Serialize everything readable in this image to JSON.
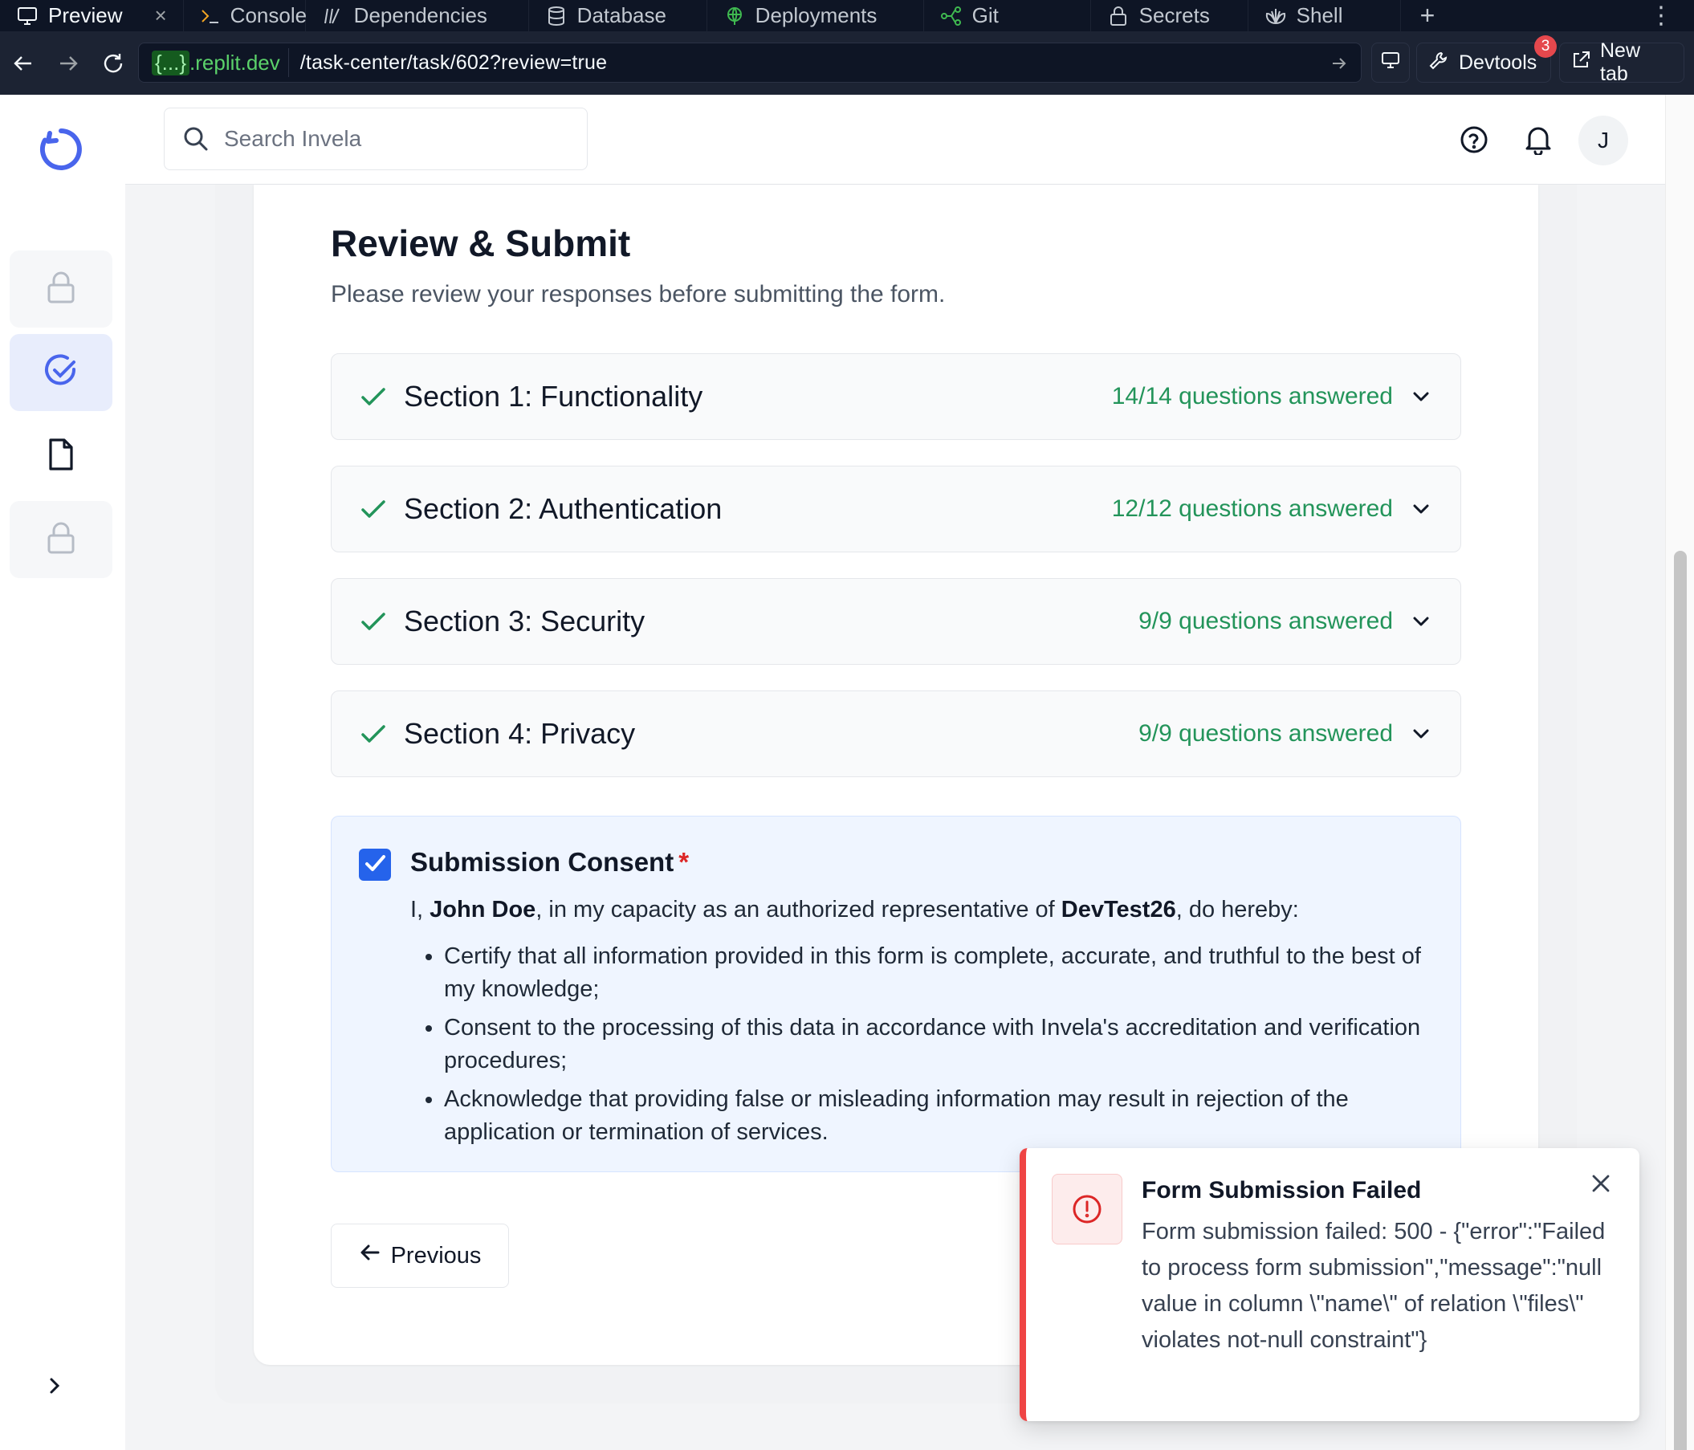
{
  "browser": {
    "tabs": [
      {
        "label": "Preview",
        "icon": "monitor-icon"
      },
      {
        "label": "Console",
        "icon": "terminal-icon"
      },
      {
        "label": "Dependencies",
        "icon": "package-icon"
      },
      {
        "label": "Database",
        "icon": "database-icon"
      },
      {
        "label": "Deployments",
        "icon": "globe-icon"
      },
      {
        "label": "Git",
        "icon": "git-icon"
      },
      {
        "label": "Secrets",
        "icon": "lock-icon"
      },
      {
        "label": "Shell",
        "icon": "shell-icon"
      }
    ],
    "tab_close_glyph": "×",
    "new_tab_glyph": "+",
    "more_glyph": "⋮",
    "url": {
      "domain_brace": "{...}",
      "domain_suffix": ".replit.dev",
      "path": "/task-center/task/602?review=true"
    },
    "devtools_label": "Devtools",
    "devtools_badge": "3",
    "new_tab_label": "New tab"
  },
  "header": {
    "search_placeholder": "Search Invela",
    "avatar_initial": "J"
  },
  "page": {
    "title": "Review & Submit",
    "subtitle": "Please review your responses before submitting the form.",
    "sections": [
      {
        "title": "Section 1: Functionality",
        "count": "14/14 questions answered"
      },
      {
        "title": "Section 2: Authentication",
        "count": "12/12 questions answered"
      },
      {
        "title": "Section 3: Security",
        "count": "9/9 questions answered"
      },
      {
        "title": "Section 4: Privacy",
        "count": "9/9 questions answered"
      }
    ],
    "consent": {
      "title": "Submission Consent",
      "required_mark": "*",
      "checked": true,
      "intro_prefix": "I, ",
      "name": "John Doe",
      "intro_middle": ", in my capacity as an authorized representative of ",
      "company": "DevTest26",
      "intro_suffix": ", do hereby:",
      "items": [
        "Certify that all information provided in this form is complete, accurate, and truthful to the best of my knowledge;",
        "Consent to the processing of this data in accordance with Invela's accreditation and verification procedures;",
        "Acknowledge that providing false or misleading information may result in rejection of the application or termination of services."
      ]
    },
    "previous_label": "Previous"
  },
  "toast": {
    "title": "Form Submission Failed",
    "message": "Form submission failed: 500 - {\"error\":\"Failed to process form submission\",\"message\":\"null value in column \\\"name\\\" of relation \\\"files\\\" violates not-null constraint\"}"
  },
  "colors": {
    "accent": "#2563eb",
    "success": "#23945a",
    "error": "#ef4444",
    "chrome_bg": "#0e1525"
  }
}
